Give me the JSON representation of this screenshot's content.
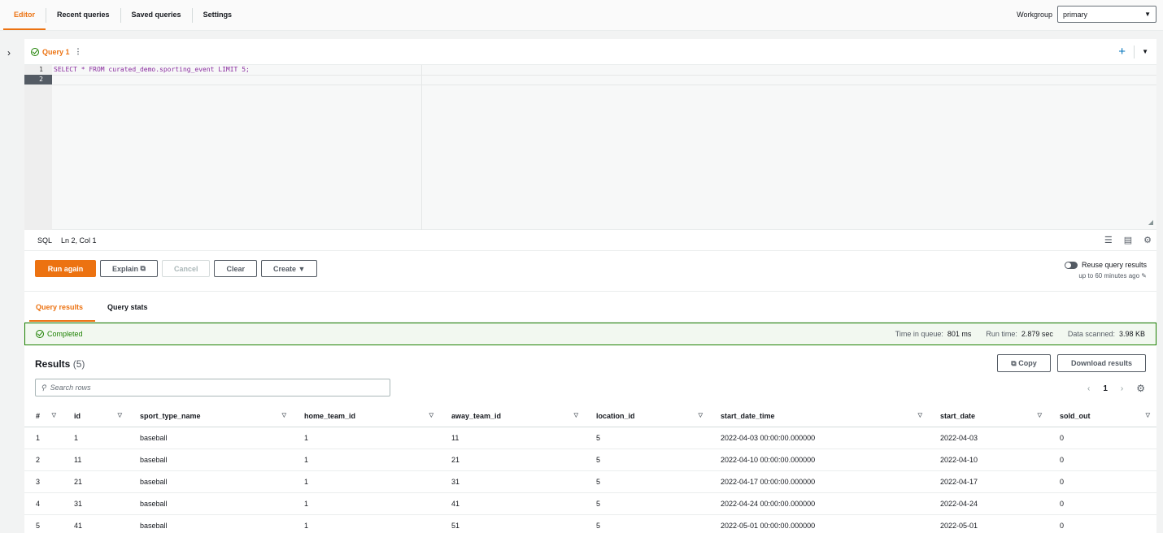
{
  "top_tabs": [
    "Editor",
    "Recent queries",
    "Saved queries",
    "Settings"
  ],
  "workgroup": {
    "label": "Workgroup",
    "value": "primary"
  },
  "query_tab": {
    "label": "Query 1"
  },
  "editor": {
    "lines": [
      "1",
      "2"
    ],
    "sql": "SELECT * FROM curated_demo.sporting_event LIMIT 5;"
  },
  "status": {
    "language": "SQL",
    "cursor": "Ln 2, Col 1"
  },
  "actions": {
    "run": "Run again",
    "explain": "Explain",
    "cancel": "Cancel",
    "clear": "Clear",
    "create": "Create"
  },
  "reuse": {
    "label": "Reuse query results",
    "sub": "up to 60 minutes ago"
  },
  "result_tabs": [
    "Query results",
    "Query stats"
  ],
  "completion": {
    "status": "Completed",
    "time_in_queue_label": "Time in queue:",
    "time_in_queue": "801 ms",
    "run_time_label": "Run time:",
    "run_time": "2.879 sec",
    "data_scanned_label": "Data scanned:",
    "data_scanned": "3.98 KB"
  },
  "results": {
    "title": "Results",
    "count": "(5)",
    "copy": "Copy",
    "download": "Download results",
    "search_placeholder": "Search rows",
    "page": "1",
    "columns": [
      "#",
      "id",
      "sport_type_name",
      "home_team_id",
      "away_team_id",
      "location_id",
      "start_date_time",
      "start_date",
      "sold_out"
    ],
    "rows": [
      [
        "1",
        "1",
        "baseball",
        "1",
        "11",
        "5",
        "2022-04-03 00:00:00.000000",
        "2022-04-03",
        "0"
      ],
      [
        "2",
        "11",
        "baseball",
        "1",
        "21",
        "5",
        "2022-04-10 00:00:00.000000",
        "2022-04-10",
        "0"
      ],
      [
        "3",
        "21",
        "baseball",
        "1",
        "31",
        "5",
        "2022-04-17 00:00:00.000000",
        "2022-04-17",
        "0"
      ],
      [
        "4",
        "31",
        "baseball",
        "1",
        "41",
        "5",
        "2022-04-24 00:00:00.000000",
        "2022-04-24",
        "0"
      ],
      [
        "5",
        "41",
        "baseball",
        "1",
        "51",
        "5",
        "2022-05-01 00:00:00.000000",
        "2022-05-01",
        "0"
      ]
    ]
  }
}
